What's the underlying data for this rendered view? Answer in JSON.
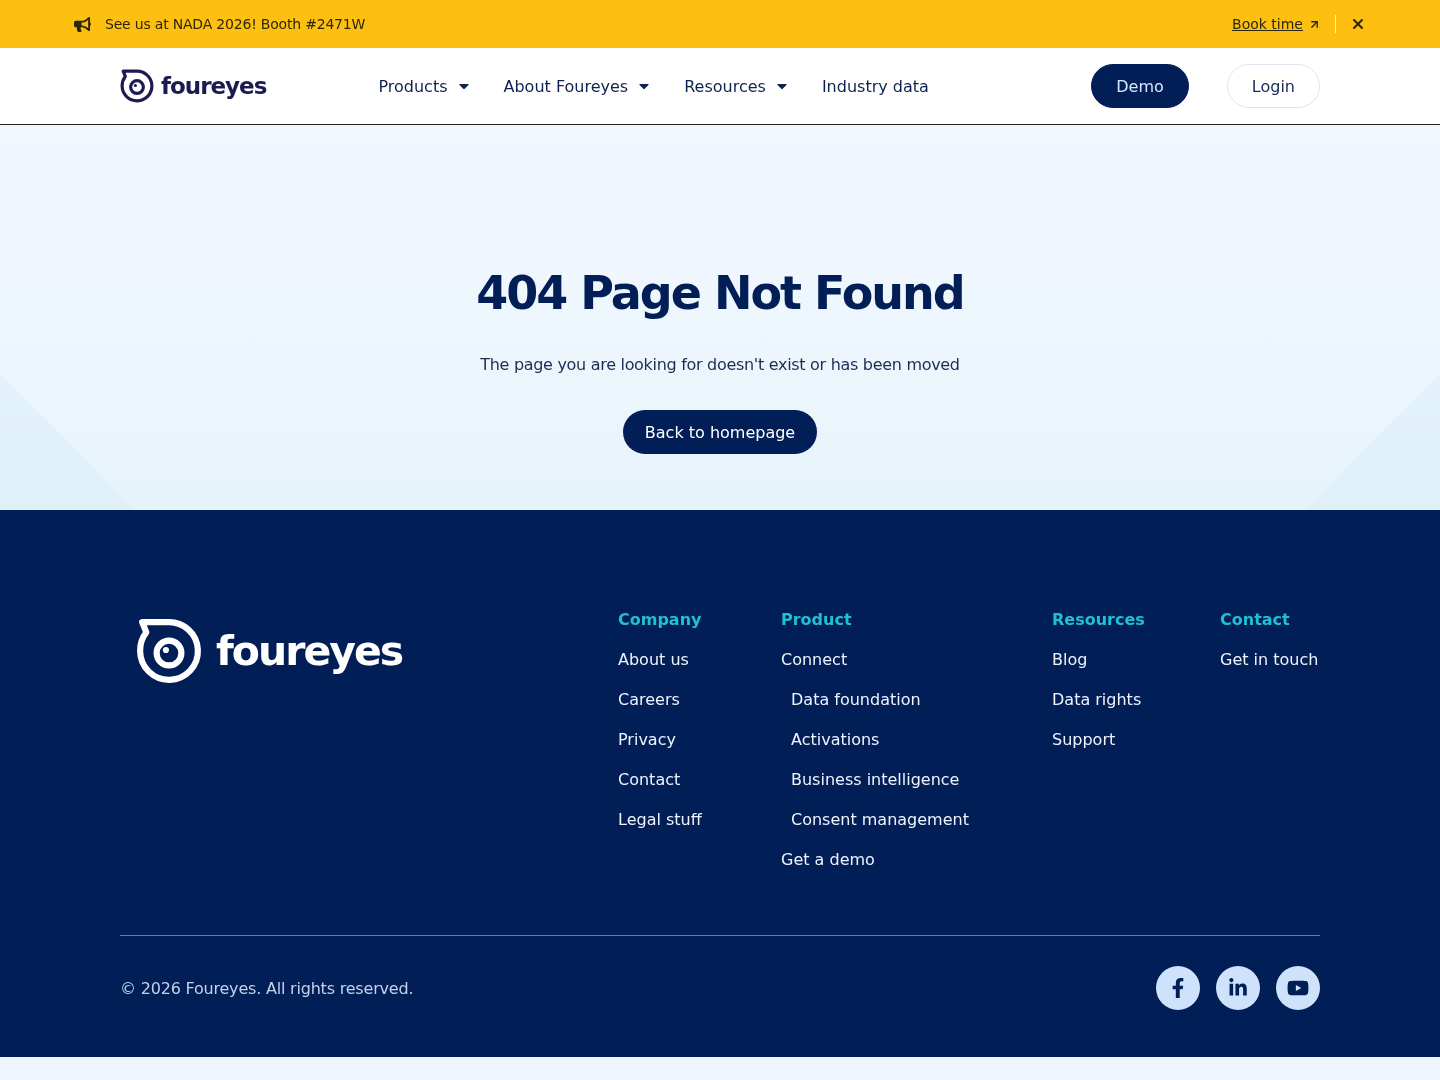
{
  "announcement_bar": {
    "text": "See us at NADA 2026! Booth #2471W",
    "link": "Book time"
  },
  "header": {
    "logo": "foureyes",
    "nav": [
      {
        "label": "Products",
        "dropdown": true
      },
      {
        "label": "About Foureyes",
        "dropdown": true
      },
      {
        "label": "Resources",
        "dropdown": true
      },
      {
        "label": "Industry data",
        "dropdown": false
      }
    ],
    "buttons": [
      {
        "label": "Demo",
        "kind": "primary"
      },
      {
        "label": "Login",
        "kind": "outline"
      }
    ]
  },
  "hero": {
    "title": "404 Page Not Found",
    "message": "The page you are looking for doesn't exist or has been moved",
    "button": "Back to homepage"
  },
  "footer": {
    "logo": "foureyes",
    "columns": [
      {
        "heading": "Company",
        "links": [
          {
            "label": "About us"
          },
          {
            "label": "Careers"
          },
          {
            "label": "Privacy"
          },
          {
            "label": "Contact"
          },
          {
            "label": "Legal stuff"
          }
        ]
      },
      {
        "heading": "Product",
        "links": [
          {
            "label": "Connect",
            "children": [
              {
                "label": "Data foundation"
              },
              {
                "label": "Activations"
              },
              {
                "label": "Business intelligence"
              },
              {
                "label": "Consent management"
              }
            ]
          },
          {
            "label": "Get a demo"
          }
        ]
      },
      {
        "heading": "Resources",
        "links": [
          {
            "label": "Blog"
          },
          {
            "label": "Data rights"
          },
          {
            "label": "Support"
          }
        ]
      },
      {
        "heading": "Contact",
        "links": [
          {
            "label": "Get in touch"
          }
        ]
      }
    ],
    "copyright": "© 2026 Foureyes. All rights reserved.",
    "social": [
      {
        "kind": "facebook"
      },
      {
        "kind": "linkedin"
      },
      {
        "kind": "youtube"
      }
    ]
  }
}
